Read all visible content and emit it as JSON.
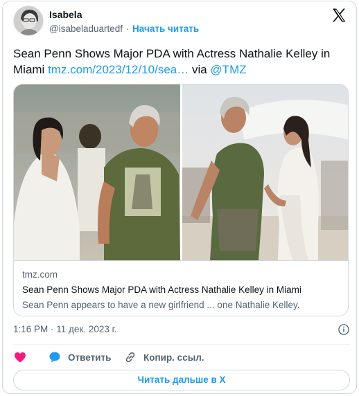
{
  "author": {
    "name": "Isabela",
    "handle": "@isabeladuartedf",
    "separator": "·",
    "follow_label": "Начать читать"
  },
  "tweet": {
    "text": "Sean Penn Shows Major PDA with Actress Nathalie Kelley in Miami ",
    "link_text": "tmz.com/2023/12/10/sea…",
    "via_text": " via ",
    "mention": "@TMZ"
  },
  "link_card": {
    "domain": "tmz.com",
    "title": "Sean Penn Shows Major PDA with Actress Nathalie Kelley in Miami",
    "description": "Sean Penn appears to have a new girlfriend ... one Nathalie Kelley."
  },
  "timestamp": "1:16 PM · 11 дек. 2023 г.",
  "actions": {
    "reply_label": "Ответить",
    "copy_label": "Копир. ссыл."
  },
  "read_more_label": "Читать дальше в X",
  "colors": {
    "accent": "#1d9bf0",
    "like": "#f91880",
    "text": "#0f1419",
    "secondary_text": "#536471",
    "border": "#cfd9de"
  }
}
